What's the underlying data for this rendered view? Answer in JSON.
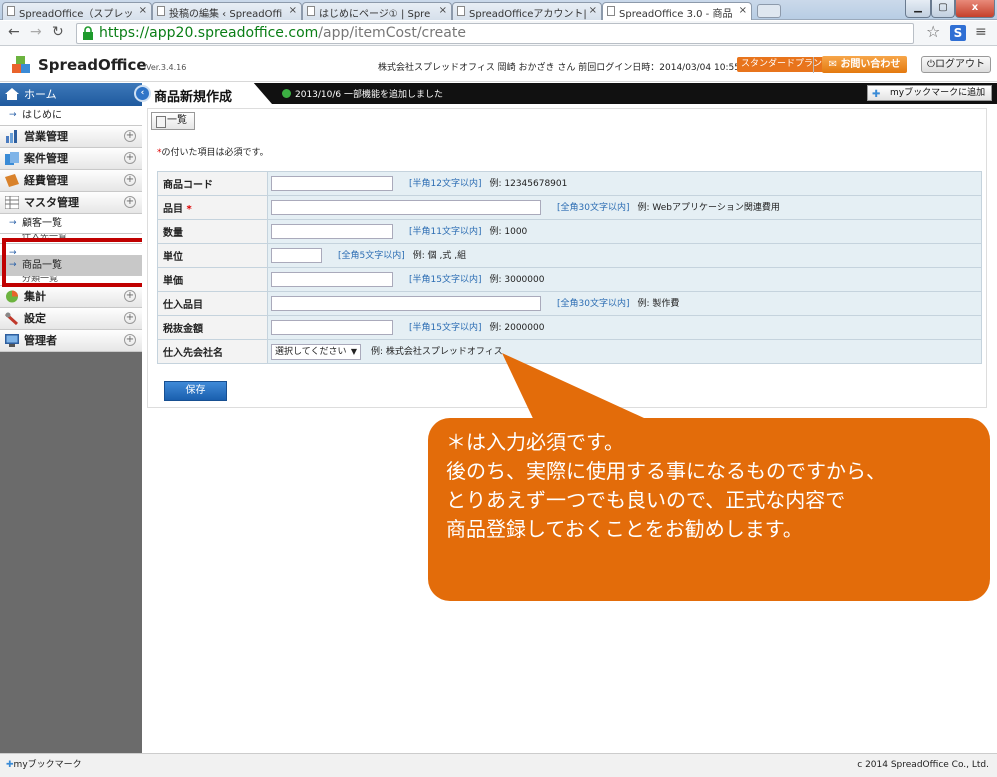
{
  "browser": {
    "tabs": [
      {
        "label": "SpreadOffice（スプレッ"
      },
      {
        "label": "投稿の編集 ‹ SpreadOffi"
      },
      {
        "label": "はじめにページ① | Spre"
      },
      {
        "label": "SpreadOfficeアカウント|"
      },
      {
        "label": "SpreadOffice 3.0 - 商品"
      }
    ],
    "url_host": "https://app20.spreadoffice.com",
    "url_path": "/app/itemCost/create"
  },
  "header": {
    "logo": "SpreadOffice",
    "version": "Ver.3.4.16",
    "user_info": "株式会社スプレッドオフィス 岡崎 おかざき さん 前回ログイン日時：2014/03/04 10:55:26",
    "plan": "スタンダードプラン",
    "contact": "お問い合わせ",
    "logout": "ログアウト"
  },
  "sidebar": {
    "home": "ホーム",
    "intro": "はじめに",
    "groups": [
      {
        "label": "営業管理"
      },
      {
        "label": "案件管理"
      },
      {
        "label": "経費管理"
      },
      {
        "label": "マスタ管理"
      }
    ],
    "master_items": [
      {
        "label": "顧客一覧"
      },
      {
        "label": "仕入先一覧"
      },
      {
        "label": "商品一覧"
      },
      {
        "label": "分類一覧"
      }
    ],
    "groups2": [
      {
        "label": "集計"
      },
      {
        "label": "設定"
      },
      {
        "label": "管理者"
      }
    ]
  },
  "main": {
    "title": "商品新規作成",
    "notice": "2013/10/6 一部機能を追加しました",
    "bookmark": "myブックマークに追加",
    "list_button": "一覧",
    "required_note": "の付いた項目は必須です。",
    "required_mark": "*",
    "fields": [
      {
        "label": "商品コード",
        "hint": "[半角12文字以内]",
        "example": "例: 12345678901"
      },
      {
        "label": "品目",
        "hint": "[全角30文字以内]",
        "example": "例: Webアプリケーション関連費用"
      },
      {
        "label": "数量",
        "hint": "[半角11文字以内]",
        "example": "例: 1000"
      },
      {
        "label": "単位",
        "hint": "[全角5文字以内]",
        "example": "例: 個 ,式 ,組"
      },
      {
        "label": "単価",
        "hint": "[半角15文字以内]",
        "example": "例: 3000000"
      },
      {
        "label": "仕入品目",
        "hint": "[全角30文字以内]",
        "example": "例: 製作費"
      },
      {
        "label": "税抜金額",
        "hint": "[半角15文字以内]",
        "example": "例: 2000000"
      },
      {
        "label": "仕入先会社名",
        "select": "選択してください",
        "example": "例: 株式会社スプレッドオフィス"
      }
    ],
    "save": "保存"
  },
  "callout": {
    "line1": "＊は入力必須です。",
    "line2": "後のち、実際に使用する事になるものですから、",
    "line3": "とりあえず一つでも良いので、正式な内容で",
    "line4": "商品登録しておくことをお勧めします。"
  },
  "footer": {
    "bookmark": "myブックマーク",
    "copyright": "c 2014 SpreadOffice Co., Ltd."
  }
}
